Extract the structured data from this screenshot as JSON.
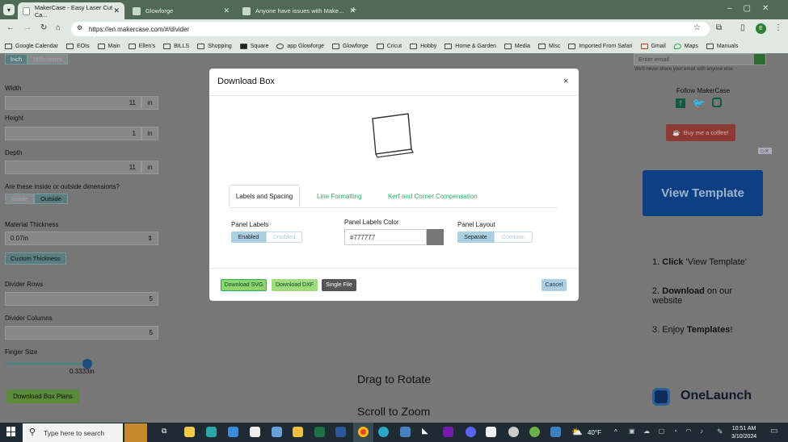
{
  "browser": {
    "tabs": [
      {
        "label": "MakerCase - Easy Laser Cut Ca..."
      },
      {
        "label": "Glowforge"
      },
      {
        "label": "Anyone have issues with Make..."
      }
    ],
    "new_tab_glyph": "+",
    "url": "https://en.makercase.com/#/divider",
    "profile_initial": "E",
    "bookmarks": [
      "Google Calendar",
      "EOIs",
      "Main",
      "Ellen's",
      "BILLS",
      "Shopping",
      "Square",
      "app Glowforge",
      "Glowforge",
      "Cricut",
      "Hobby",
      "Home & Garden",
      "Media",
      "Misc",
      "Imported From Safari",
      "Gmail",
      "Maps",
      "Manuals"
    ]
  },
  "left_panel": {
    "unit_options": [
      "Inch",
      "Millimeters"
    ],
    "width": {
      "label": "Width",
      "value": "11",
      "unit": "in"
    },
    "height": {
      "label": "Height",
      "value": "1",
      "unit": "in"
    },
    "depth": {
      "label": "Depth",
      "value": "11",
      "unit": "in"
    },
    "dims_question": "Are these inside or outside dimensions?",
    "dims_options": [
      "Inside",
      "Outside"
    ],
    "material_label": "Material Thickness",
    "material_value": "0.07in",
    "custom_thickness": "Custom Thickness",
    "divider_rows": {
      "label": "Divider Rows",
      "value": "5"
    },
    "divider_columns": {
      "label": "Divider Columns",
      "value": "5"
    },
    "finger_size": {
      "label": "Finger Size",
      "value": "0.3333in",
      "slider_fraction": 0.98
    },
    "download_plans": "Download Box Plans"
  },
  "center": {
    "drag_text": "Drag to Rotate",
    "scroll_text": "Scroll to Zoom"
  },
  "right_panel": {
    "email_placeholder": "Enter email",
    "email_note": "We'll never share your email with anyone else.",
    "follow": "Follow MakerCase",
    "coffee": "Buy me a coffee!",
    "ad_button": "View Template",
    "steps": [
      {
        "num": "1.",
        "bold": "Click",
        "rest": " 'View Template'"
      },
      {
        "num": "2.",
        "bold": "Download",
        "rest": " on our website"
      },
      {
        "num": "3.",
        "pre": " Enjoy ",
        "bold": "Templates",
        "rest": "!"
      }
    ],
    "onelaunch": "OneLaunch"
  },
  "modal": {
    "title": "Download Box",
    "close": "×",
    "tabs": [
      "Labels and Spacing",
      "Line Formatting",
      "Kerf and Corner Compensation"
    ],
    "panel_labels": {
      "label": "Panel Labels",
      "options": [
        "Enabled",
        "Disabled"
      ]
    },
    "panel_labels_color": {
      "label": "Panel Labels Color",
      "value": "#777777",
      "swatch": "#777777"
    },
    "panel_layout": {
      "label": "Panel Layout",
      "options": [
        "Separate",
        "Combine"
      ]
    },
    "buttons": {
      "svg": "Download SVG",
      "dxf": "Download DXF",
      "single": "Single File",
      "cancel": "Cancel"
    }
  },
  "taskbar": {
    "search_placeholder": "Type here to search",
    "weather": "40°F",
    "time": "10:51 AM",
    "date": "3/10/2024"
  },
  "colors": {
    "accent_green": "#27ae60",
    "brand_red": "#e74c3c",
    "ad_blue": "#1565c0"
  }
}
